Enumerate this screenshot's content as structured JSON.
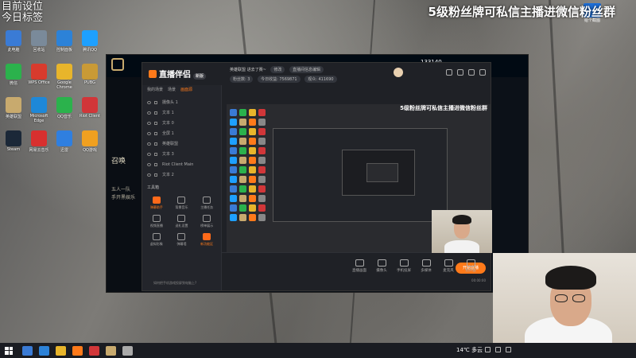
{
  "overlay": {
    "top_left_line1": "目前设位",
    "top_left_line2": "今日标签",
    "top_right_banner": "5级粉丝牌可私信主播进微信粉丝群"
  },
  "desktop_icons": [
    {
      "label": "此电脑",
      "color": "#3a7bd5"
    },
    {
      "label": "回收站",
      "color": "#7a8a9a"
    },
    {
      "label": "控制面板",
      "color": "#2c82d8"
    },
    {
      "label": "腾讯QQ",
      "color": "#1ea0ff"
    },
    {
      "label": "微信",
      "color": "#2bb24c"
    },
    {
      "label": "WPS Office",
      "color": "#d83b2d"
    },
    {
      "label": "Google Chrome",
      "color": "#e8b52b"
    },
    {
      "label": "PUBG",
      "color": "#c99a36"
    },
    {
      "label": "英雄联盟",
      "color": "#c8aa6e"
    },
    {
      "label": "Microsoft Edge",
      "color": "#1e88d8"
    },
    {
      "label": "QQ音乐",
      "color": "#2bb24c"
    },
    {
      "label": "Riot Client",
      "color": "#d13639"
    },
    {
      "label": "Steam",
      "color": "#1b2838"
    },
    {
      "label": "网易云音乐",
      "color": "#d8302f"
    },
    {
      "label": "迅雷",
      "color": "#2f7fe0"
    },
    {
      "label": "QQ游戏",
      "color": "#f0a020"
    }
  ],
  "right_icon_label": "给个截图",
  "lol": {
    "coins": "133140",
    "left_text_1": "召唤",
    "left_text_2": "五人一队",
    "left_text_3": "手开黑娱乐"
  },
  "zb": {
    "app_name": "直播伴侣",
    "badge": "新版",
    "tabs": [
      "我的场景",
      "场景",
      "画面源"
    ],
    "sources": [
      "摄像头 1",
      "文本 1",
      "文本 0",
      "全屏 1",
      "英雄联盟",
      "文本 3",
      "Riot Client Main",
      "文本 2"
    ],
    "tools_title": "工具箱",
    "tools": [
      "弹幕助手",
      "背景音乐",
      "主播任务",
      "视频直播",
      "送礼设置",
      "榜单展示",
      "虚拟形象",
      "弹幕墙",
      "新功能区"
    ],
    "footer_note": "如何把手机游戏投屏到电脑上?",
    "title_line": "英雄联盟 进去了赛~",
    "title_pill_1": "修改",
    "title_pill_2": "直播间信息编辑",
    "stats": [
      "粉丝数: 3",
      "今日收益: 7569871",
      "观众: 411690"
    ],
    "preview_banner": "5级粉丝牌可私信主播进微信粉丝群",
    "bottom_buttons": [
      "直播画面",
      "摄像头",
      "手机投屏",
      "多媒体",
      "麦克风",
      "扬声器"
    ],
    "start_label": "开始直播",
    "time": "00:00:00"
  },
  "taskbar": {
    "weather": "14℃ 多云",
    "icon_colors": [
      "#3a7bd5",
      "#2c82d8",
      "#e8b52b",
      "#ff7a1a",
      "#d13639",
      "#c8aa6e",
      "#aaaaaa"
    ]
  }
}
